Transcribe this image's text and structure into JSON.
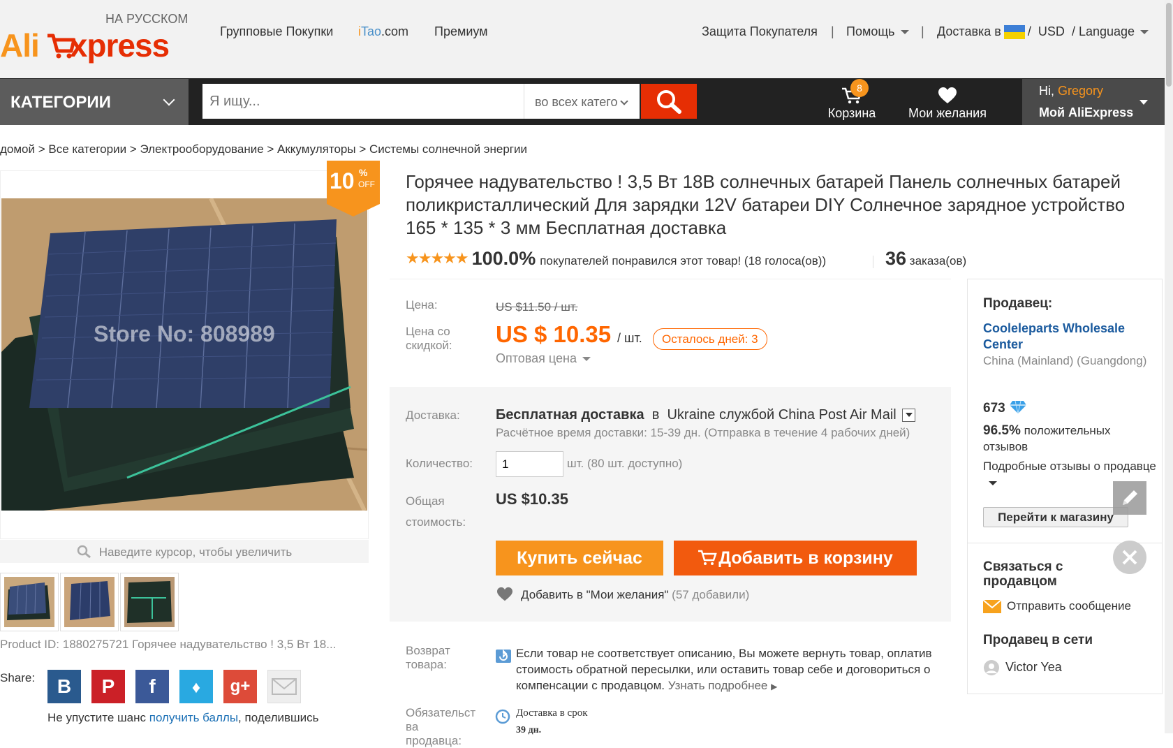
{
  "header": {
    "logo_sub": "НА РУССКОМ",
    "logo_ali": "Ali",
    "logo_express": "xpress",
    "nav": [
      "Групповые Покупки",
      "iTao.com",
      "Премиум"
    ],
    "itao_i": "i",
    "itao_tao": "Tao",
    "itao_com": ".com",
    "buyer_protection": "Защита Покупателя",
    "help": "Помощь",
    "delivery_to": "Доставка в",
    "currency": "USD",
    "language": "Language",
    "sep": "|",
    "slash": "/"
  },
  "navbar": {
    "categories": "КАТЕГОРИИ",
    "search_placeholder": "Я ищу...",
    "search_category": "во всех катего",
    "cart": "Корзина",
    "cart_count": "8",
    "wishlist": "Мои желания",
    "greeting": "Hi,",
    "user_name": "Gregory",
    "my_aliexpress": "Мой AliExpress"
  },
  "breadcrumb": "домой > Все категории > Электрооборудование > Аккумуляторы > Системы солнечной энергии",
  "gallery": {
    "discount_value": "10",
    "discount_pct": "%",
    "discount_off": "OFF",
    "watermark": "Store No: 808989",
    "zoom_hint": "Наведите курсор, чтобы увеличить",
    "product_id": "Product ID: 1880275721 Горячее надувательство ! 3,5 Вт 18...",
    "share_label": "Share:",
    "points_pre": "Не упустите шанс",
    "points_link": "получить баллы",
    "points_post": ", поделившись"
  },
  "product": {
    "title": "Горячее надувательство ! 3,5 Вт 18В солнечных батарей Панель солнечных батарей поликристаллический Для зарядки 12V батареи DIY Солнечное зарядное устройство 165 * 135 * 3 мм Бесплатная доставка",
    "stars": "★★★★★",
    "rating_pct": "100.0%",
    "rating_text": "покупателей понравился этот товар! (18 голоса(ов))",
    "orders_count": "36",
    "orders_label": "заказа(ов)",
    "price_label": "Цена:",
    "old_price": "US $11.50 / шт.",
    "discount_label": "Цена со скидкой:",
    "new_price": "US $ 10.35",
    "unit": "/ шт.",
    "days_left": "Осталось дней: 3",
    "wholesale": "Оптовая цена",
    "shipping_label": "Доставка:",
    "shipping_free": "Бесплатная доставка",
    "shipping_in": "в",
    "shipping_dest": "Ukraine службой China Post Air Mail",
    "shipping_time": "Расчётное время доставки: 15-39 дн. (Отправка в течение 4 рабочих дней)",
    "qty_label": "Количество:",
    "qty_value": "1",
    "qty_avail": "шт. (80 шт. доступно)",
    "total_label": "Общая стоимость:",
    "total": "US $10.35",
    "buy_now": "Купить сейчас",
    "add_to_cart": "Добавить в корзину",
    "add_wish": "Добавить в \"Мои желания\"",
    "wish_count": "(57 добавили)",
    "return_label": "Возврат товара:",
    "return_text": "Если товар не соответствует описанию, Вы можете вернуть товар, оплатив стоимость обратной пересылки, или оставить товар себе и договориться о компенсации с продавцом.",
    "return_more": "Узнать подробнее",
    "guarantee_label": "Обязательст ва продавца:",
    "guarantee_text": "Доставка в срок",
    "guarantee_days": "39 дн."
  },
  "seller": {
    "title": "Продавец:",
    "name": "Cooleleparts Wholesale Center",
    "location": "China (Mainland) (Guangdong)",
    "score": "673",
    "positive_pct": "96.5%",
    "positive_text": "положительных отзывов",
    "feedback_link": "Подробные отзывы о продавце",
    "go_store": "Перейти к магазину",
    "contact_title": "Связаться с продавцом",
    "send_message": "Отправить сообщение",
    "online_title": "Продавец в сети",
    "online_name": "Victor Yea"
  },
  "colors": {
    "brand_red": "#e62e04",
    "brand_orange": "#f7941d",
    "price_orange": "#ff6600"
  }
}
